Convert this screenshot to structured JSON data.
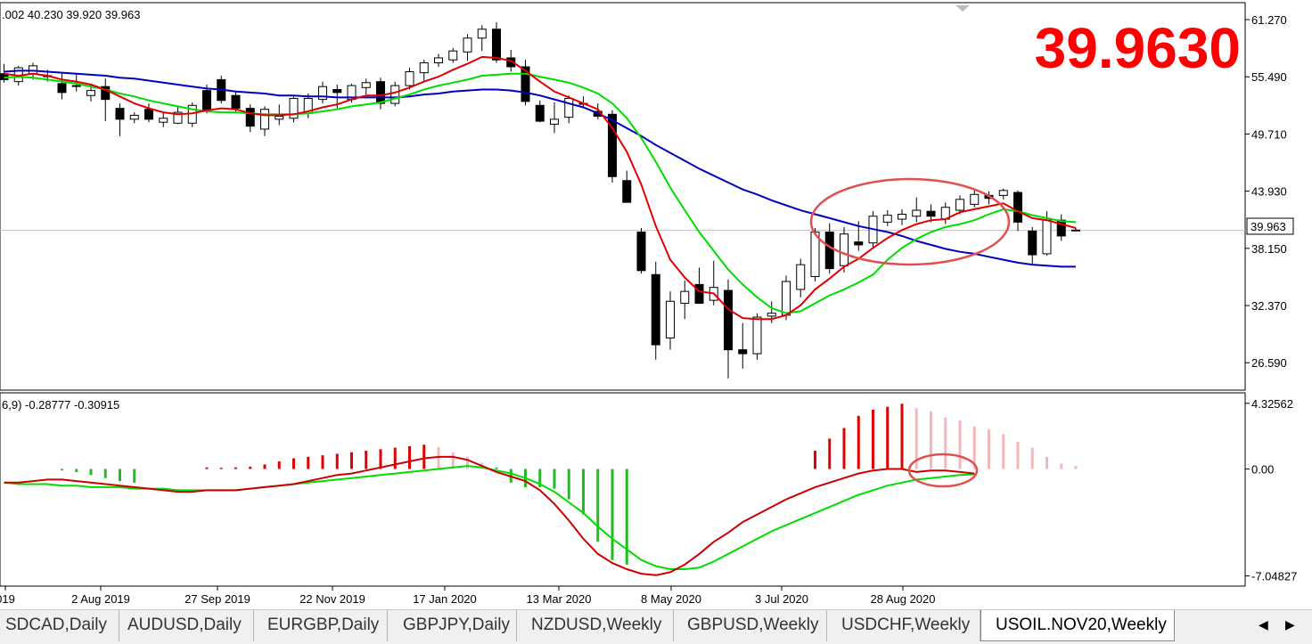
{
  "window": {
    "big_price": "39.9630",
    "main_info": ".002 40.230 39.920 39.963",
    "sub_info": "6,9) -0.28777 -0.30915",
    "current_price_tag": "39.963"
  },
  "colors": {
    "bull_fill": "#ffffff",
    "bear_fill": "#000000",
    "ma_fast": "#e00000",
    "ma_mid": "#00dd00",
    "ma_slow": "#0000c0",
    "macd_line": "#cc0000",
    "signal_line": "#00dd00",
    "hist_pos_strong": "#e00000",
    "hist_pos_weak": "#f5b8b8",
    "hist_neg": "#22bb22",
    "annotation": "#e05050",
    "big_price_color": "#ff0000"
  },
  "chart_data": [
    {
      "type": "candlestick",
      "title": "USOIL.NOV20,Weekly",
      "ylim": [
        24.0,
        62.8
      ],
      "y_ticks": [
        "61.270",
        "55.490",
        "49.710",
        "43.930",
        "38.150",
        "32.370",
        "26.590"
      ],
      "current_price": 39.963,
      "candles": [
        {
          "o": 55.8,
          "h": 56.8,
          "l": 54.9,
          "c": 55.2
        },
        {
          "o": 55.0,
          "h": 56.6,
          "l": 54.6,
          "c": 56.4
        },
        {
          "o": 55.8,
          "h": 56.9,
          "l": 55.2,
          "c": 56.6
        },
        {
          "o": 55.6,
          "h": 56.2,
          "l": 55.0,
          "c": 55.5
        },
        {
          "o": 54.8,
          "h": 55.9,
          "l": 53.2,
          "c": 53.9
        },
        {
          "o": 54.6,
          "h": 55.8,
          "l": 54.0,
          "c": 54.6
        },
        {
          "o": 53.6,
          "h": 54.8,
          "l": 53.0,
          "c": 54.1
        },
        {
          "o": 54.5,
          "h": 55.3,
          "l": 51.0,
          "c": 53.2
        },
        {
          "o": 52.3,
          "h": 52.8,
          "l": 49.5,
          "c": 51.2
        },
        {
          "o": 51.2,
          "h": 51.9,
          "l": 50.8,
          "c": 51.6
        },
        {
          "o": 52.2,
          "h": 52.8,
          "l": 50.9,
          "c": 51.2
        },
        {
          "o": 50.9,
          "h": 51.9,
          "l": 50.4,
          "c": 51.3
        },
        {
          "o": 50.8,
          "h": 52.4,
          "l": 50.7,
          "c": 51.9
        },
        {
          "o": 50.8,
          "h": 52.9,
          "l": 50.4,
          "c": 52.6
        },
        {
          "o": 54.1,
          "h": 54.7,
          "l": 51.8,
          "c": 52.1
        },
        {
          "o": 55.2,
          "h": 55.6,
          "l": 52.8,
          "c": 53.1
        },
        {
          "o": 53.6,
          "h": 54.1,
          "l": 51.8,
          "c": 52.3
        },
        {
          "o": 52.3,
          "h": 52.7,
          "l": 49.9,
          "c": 50.5
        },
        {
          "o": 50.2,
          "h": 52.5,
          "l": 49.5,
          "c": 52.2
        },
        {
          "o": 51.2,
          "h": 52.7,
          "l": 50.6,
          "c": 51.5
        },
        {
          "o": 51.3,
          "h": 53.5,
          "l": 50.9,
          "c": 53.3
        },
        {
          "o": 51.8,
          "h": 53.8,
          "l": 51.3,
          "c": 53.3
        },
        {
          "o": 53.2,
          "h": 55.0,
          "l": 52.8,
          "c": 54.5
        },
        {
          "o": 54.2,
          "h": 54.7,
          "l": 52.3,
          "c": 53.9
        },
        {
          "o": 53.2,
          "h": 54.8,
          "l": 52.9,
          "c": 54.6
        },
        {
          "o": 54.4,
          "h": 55.3,
          "l": 53.7,
          "c": 54.9
        },
        {
          "o": 55.0,
          "h": 55.4,
          "l": 52.2,
          "c": 52.8
        },
        {
          "o": 52.8,
          "h": 55.0,
          "l": 52.5,
          "c": 54.6
        },
        {
          "o": 54.6,
          "h": 56.4,
          "l": 54.2,
          "c": 56.0
        },
        {
          "o": 55.9,
          "h": 57.2,
          "l": 55.1,
          "c": 56.9
        },
        {
          "o": 56.9,
          "h": 57.8,
          "l": 56.5,
          "c": 57.4
        },
        {
          "o": 57.2,
          "h": 58.4,
          "l": 56.9,
          "c": 58.1
        },
        {
          "o": 58.0,
          "h": 59.8,
          "l": 57.1,
          "c": 59.4
        },
        {
          "o": 59.4,
          "h": 60.7,
          "l": 58.1,
          "c": 60.3
        },
        {
          "o": 60.3,
          "h": 61.0,
          "l": 56.9,
          "c": 57.2
        },
        {
          "o": 57.4,
          "h": 58.2,
          "l": 56.0,
          "c": 56.5
        },
        {
          "o": 56.5,
          "h": 57.2,
          "l": 52.6,
          "c": 53.0
        },
        {
          "o": 52.6,
          "h": 53.1,
          "l": 50.9,
          "c": 51.0
        },
        {
          "o": 50.7,
          "h": 52.9,
          "l": 49.8,
          "c": 51.2
        },
        {
          "o": 51.4,
          "h": 53.6,
          "l": 50.8,
          "c": 53.3
        },
        {
          "o": 52.8,
          "h": 53.5,
          "l": 52.5,
          "c": 52.8
        },
        {
          "o": 52.0,
          "h": 52.8,
          "l": 51.2,
          "c": 51.5
        },
        {
          "o": 51.7,
          "h": 52.1,
          "l": 44.8,
          "c": 45.4
        },
        {
          "o": 45.0,
          "h": 46.0,
          "l": 42.9,
          "c": 42.8
        },
        {
          "o": 39.8,
          "h": 40.2,
          "l": 35.6,
          "c": 35.9
        },
        {
          "o": 35.5,
          "h": 36.8,
          "l": 26.9,
          "c": 28.4
        },
        {
          "o": 29.1,
          "h": 33.8,
          "l": 27.9,
          "c": 32.8
        },
        {
          "o": 32.6,
          "h": 34.9,
          "l": 31.0,
          "c": 33.8
        },
        {
          "o": 34.5,
          "h": 36.2,
          "l": 32.6,
          "c": 32.6
        },
        {
          "o": 32.9,
          "h": 36.9,
          "l": 32.4,
          "c": 34.2
        },
        {
          "o": 33.9,
          "h": 35.0,
          "l": 25.0,
          "c": 27.9
        },
        {
          "o": 27.9,
          "h": 30.6,
          "l": 26.0,
          "c": 27.5
        },
        {
          "o": 27.5,
          "h": 31.6,
          "l": 26.9,
          "c": 31.2
        },
        {
          "o": 31.3,
          "h": 32.8,
          "l": 30.6,
          "c": 31.6
        },
        {
          "o": 31.4,
          "h": 35.4,
          "l": 30.9,
          "c": 34.8
        },
        {
          "o": 34.0,
          "h": 37.1,
          "l": 33.2,
          "c": 36.5
        },
        {
          "o": 35.3,
          "h": 40.2,
          "l": 34.8,
          "c": 39.8
        },
        {
          "o": 39.8,
          "h": 40.7,
          "l": 35.6,
          "c": 36.1
        },
        {
          "o": 36.4,
          "h": 40.3,
          "l": 35.7,
          "c": 39.6
        },
        {
          "o": 38.8,
          "h": 40.9,
          "l": 37.9,
          "c": 38.5
        },
        {
          "o": 38.7,
          "h": 41.9,
          "l": 38.1,
          "c": 41.4
        },
        {
          "o": 40.8,
          "h": 42.0,
          "l": 40.4,
          "c": 41.5
        },
        {
          "o": 41.1,
          "h": 42.1,
          "l": 40.5,
          "c": 41.6
        },
        {
          "o": 41.4,
          "h": 43.3,
          "l": 40.8,
          "c": 42.0
        },
        {
          "o": 41.9,
          "h": 42.6,
          "l": 40.8,
          "c": 41.4
        },
        {
          "o": 41.1,
          "h": 42.8,
          "l": 40.6,
          "c": 42.3
        },
        {
          "o": 42.0,
          "h": 43.5,
          "l": 41.6,
          "c": 43.1
        },
        {
          "o": 42.6,
          "h": 44.0,
          "l": 42.3,
          "c": 43.6
        },
        {
          "o": 43.5,
          "h": 43.9,
          "l": 42.6,
          "c": 43.2
        },
        {
          "o": 43.5,
          "h": 44.2,
          "l": 43.1,
          "c": 44.0
        },
        {
          "o": 43.8,
          "h": 44.0,
          "l": 39.9,
          "c": 40.8
        },
        {
          "o": 39.9,
          "h": 40.3,
          "l": 36.6,
          "c": 37.5
        },
        {
          "o": 37.6,
          "h": 41.9,
          "l": 37.4,
          "c": 41.0
        },
        {
          "o": 41.0,
          "h": 41.6,
          "l": 38.9,
          "c": 39.4
        },
        {
          "o": 40.0,
          "h": 40.2,
          "l": 39.9,
          "c": 39.96
        }
      ],
      "ma_fast": [
        55.8,
        55.6,
        55.8,
        55.6,
        55.2,
        55.0,
        54.7,
        54.2,
        53.5,
        52.8,
        52.3,
        51.9,
        51.7,
        51.8,
        52.1,
        52.3,
        52.2,
        51.8,
        51.6,
        51.6,
        51.7,
        52.0,
        52.4,
        52.7,
        53.2,
        53.6,
        53.6,
        53.9,
        54.4,
        55.0,
        55.5,
        56.2,
        56.8,
        57.5,
        57.4,
        57.1,
        56.1,
        55.0,
        54.0,
        53.4,
        52.8,
        52.2,
        50.3,
        47.9,
        44.6,
        40.4,
        37.0,
        35.2,
        33.8,
        33.6,
        32.0,
        31.1,
        31.0,
        31.0,
        31.4,
        32.4,
        34.0,
        35.1,
        36.3,
        37.1,
        38.2,
        39.2,
        40.0,
        40.6,
        41.0,
        41.1,
        41.8,
        42.1,
        42.4,
        42.7,
        41.9,
        41.2,
        41.0,
        40.6,
        40.2
      ],
      "ma_mid": [
        55.4,
        55.5,
        55.4,
        55.2,
        55.0,
        54.8,
        54.5,
        54.2,
        53.8,
        53.5,
        53.1,
        52.8,
        52.5,
        52.2,
        52.0,
        51.9,
        51.9,
        51.8,
        51.7,
        51.7,
        51.7,
        51.8,
        52.0,
        52.2,
        52.5,
        52.7,
        52.9,
        53.3,
        53.7,
        54.2,
        54.6,
        54.9,
        55.2,
        55.6,
        55.7,
        55.8,
        55.8,
        55.5,
        55.2,
        54.9,
        54.4,
        53.8,
        52.8,
        51.3,
        49.3,
        46.9,
        44.3,
        42.0,
        39.8,
        37.9,
        36.0,
        34.5,
        33.2,
        32.1,
        31.6,
        31.8,
        32.6,
        33.4,
        34.0,
        34.7,
        35.5,
        37.0,
        38.2,
        39.1,
        39.8,
        40.3,
        40.6,
        41.0,
        41.6,
        42.1,
        41.9,
        41.5,
        41.2,
        40.9,
        40.8
      ],
      "ma_slow": [
        56.0,
        56.1,
        56.1,
        56.0,
        55.9,
        55.8,
        55.7,
        55.6,
        55.4,
        55.3,
        55.1,
        54.9,
        54.7,
        54.5,
        54.3,
        54.2,
        54.0,
        53.9,
        53.8,
        53.6,
        53.6,
        53.5,
        53.5,
        53.4,
        53.4,
        53.4,
        53.4,
        53.4,
        53.5,
        53.7,
        53.8,
        54.0,
        54.1,
        54.2,
        54.2,
        54.1,
        53.9,
        53.6,
        53.2,
        52.8,
        52.4,
        51.8,
        51.1,
        50.3,
        49.5,
        48.6,
        47.8,
        47.0,
        46.2,
        45.5,
        44.8,
        44.1,
        43.6,
        43.0,
        42.5,
        42.0,
        41.6,
        41.2,
        40.8,
        40.4,
        40.1,
        39.8,
        39.4,
        38.9,
        38.5,
        38.1,
        37.8,
        37.6,
        37.3,
        37.0,
        36.7,
        36.5,
        36.4,
        36.3,
        36.3
      ]
    },
    {
      "type": "bar",
      "title": "MACD",
      "ylim": [
        -7.6,
        4.9
      ],
      "y_ticks": [
        "4.32562",
        "0.00",
        "-7.04827"
      ],
      "histogram": [
        null,
        null,
        null,
        null,
        -0.1,
        -0.2,
        -0.4,
        -0.6,
        -0.8,
        -0.9,
        null,
        null,
        null,
        null,
        0.1,
        0.08,
        0.1,
        0.15,
        0.3,
        0.5,
        0.7,
        0.8,
        0.9,
        1.0,
        1.1,
        1.2,
        1.3,
        1.4,
        1.5,
        1.6,
        1.45,
        1.1,
        0.8,
        0.4,
        0.1,
        -0.9,
        -1.2,
        -1.2,
        -1.3,
        -2.0,
        -3.0,
        -4.8,
        -6.0,
        -6.3,
        null,
        null,
        null,
        null,
        null,
        null,
        null,
        null,
        null,
        null,
        null,
        null,
        1.2,
        2.0,
        2.7,
        3.5,
        3.9,
        4.1,
        4.3,
        4.0,
        3.8,
        3.4,
        3.2,
        2.8,
        2.6,
        2.3,
        1.8,
        1.4,
        0.8,
        0.35,
        0.2
      ],
      "histogram_emphasis": [
        "",
        "",
        "",
        "",
        "neg",
        "neg",
        "neg",
        "neg",
        "neg",
        "neg",
        "",
        "",
        "",
        "",
        "pos",
        "pos",
        "pos",
        "pos",
        "pos",
        "pos",
        "pos",
        "pos",
        "pos",
        "pos",
        "pos",
        "pos",
        "pos",
        "pos",
        "pos",
        "pos",
        "weak",
        "weak",
        "weak",
        "weak",
        "neg",
        "neg",
        "neg",
        "neg",
        "neg",
        "neg",
        "neg",
        "neg",
        "neg",
        "neg",
        "",
        "",
        "",
        "",
        "",
        "",
        "",
        "",
        "",
        "",
        "",
        "",
        "pos",
        "pos",
        "pos",
        "pos",
        "pos",
        "pos",
        "pos",
        "weak",
        "weak",
        "weak",
        "weak",
        "weak",
        "weak",
        "weak",
        "weak",
        "weak",
        "weak",
        "weak",
        "weak"
      ],
      "macd": [
        -0.9,
        -0.9,
        -0.8,
        -0.7,
        -0.7,
        -0.8,
        -0.9,
        -1.0,
        -1.1,
        -1.2,
        -1.3,
        -1.4,
        -1.5,
        -1.5,
        -1.4,
        -1.4,
        -1.4,
        -1.3,
        -1.2,
        -1.1,
        -1.0,
        -0.8,
        -0.6,
        -0.4,
        -0.3,
        -0.1,
        0.1,
        0.3,
        0.5,
        0.7,
        0.8,
        0.8,
        0.6,
        0.2,
        -0.2,
        -0.5,
        -0.8,
        -1.4,
        -2.3,
        -3.4,
        -4.6,
        -5.6,
        -6.2,
        -6.6,
        -6.9,
        -7.0,
        -6.8,
        -6.3,
        -5.6,
        -4.8,
        -4.2,
        -3.5,
        -3.0,
        -2.5,
        -2.0,
        -1.6,
        -1.2,
        -0.9,
        -0.6,
        -0.3,
        -0.1,
        0.0,
        0.0,
        -0.2,
        -0.1,
        -0.1,
        -0.2,
        -0.3
      ],
      "signal": [
        -0.9,
        -1.0,
        -1.0,
        -1.0,
        -1.1,
        -1.1,
        -1.2,
        -1.2,
        -1.2,
        -1.3,
        -1.3,
        -1.3,
        -1.4,
        -1.4,
        -1.4,
        -1.4,
        -1.4,
        -1.3,
        -1.2,
        -1.1,
        -1.0,
        -0.9,
        -0.8,
        -0.7,
        -0.6,
        -0.5,
        -0.4,
        -0.3,
        -0.2,
        -0.1,
        0.0,
        0.1,
        0.2,
        0.1,
        -0.1,
        -0.3,
        -0.6,
        -1.0,
        -1.5,
        -2.2,
        -2.9,
        -3.8,
        -4.6,
        -5.3,
        -6.0,
        -6.4,
        -6.6,
        -6.6,
        -6.5,
        -6.1,
        -5.6,
        -5.1,
        -4.6,
        -4.1,
        -3.7,
        -3.3,
        -2.9,
        -2.5,
        -2.1,
        -1.7,
        -1.4,
        -1.1,
        -0.9,
        -0.7,
        -0.6,
        -0.5,
        -0.4,
        -0.35
      ]
    }
  ],
  "x_labels": [
    "019",
    "2 Aug 2019",
    "27 Sep 2019",
    "22 Nov 2019",
    "17 Jan 2020",
    "13 Mar 2020",
    "8 May 2020",
    "3 Jul 2020",
    "28 Aug 2020"
  ],
  "tabs": [
    {
      "label": "SDCAD,Daily",
      "active": false
    },
    {
      "label": "AUDUSD,Daily",
      "active": false
    },
    {
      "label": "EURGBP,Daily",
      "active": false
    },
    {
      "label": "GBPJPY,Daily",
      "active": false
    },
    {
      "label": "NZDUSD,Weekly",
      "active": false
    },
    {
      "label": "GBPUSD,Weekly",
      "active": false
    },
    {
      "label": "USDCHF,Weekly",
      "active": false
    },
    {
      "label": "USOIL.NOV20,Weekly",
      "active": true
    }
  ]
}
